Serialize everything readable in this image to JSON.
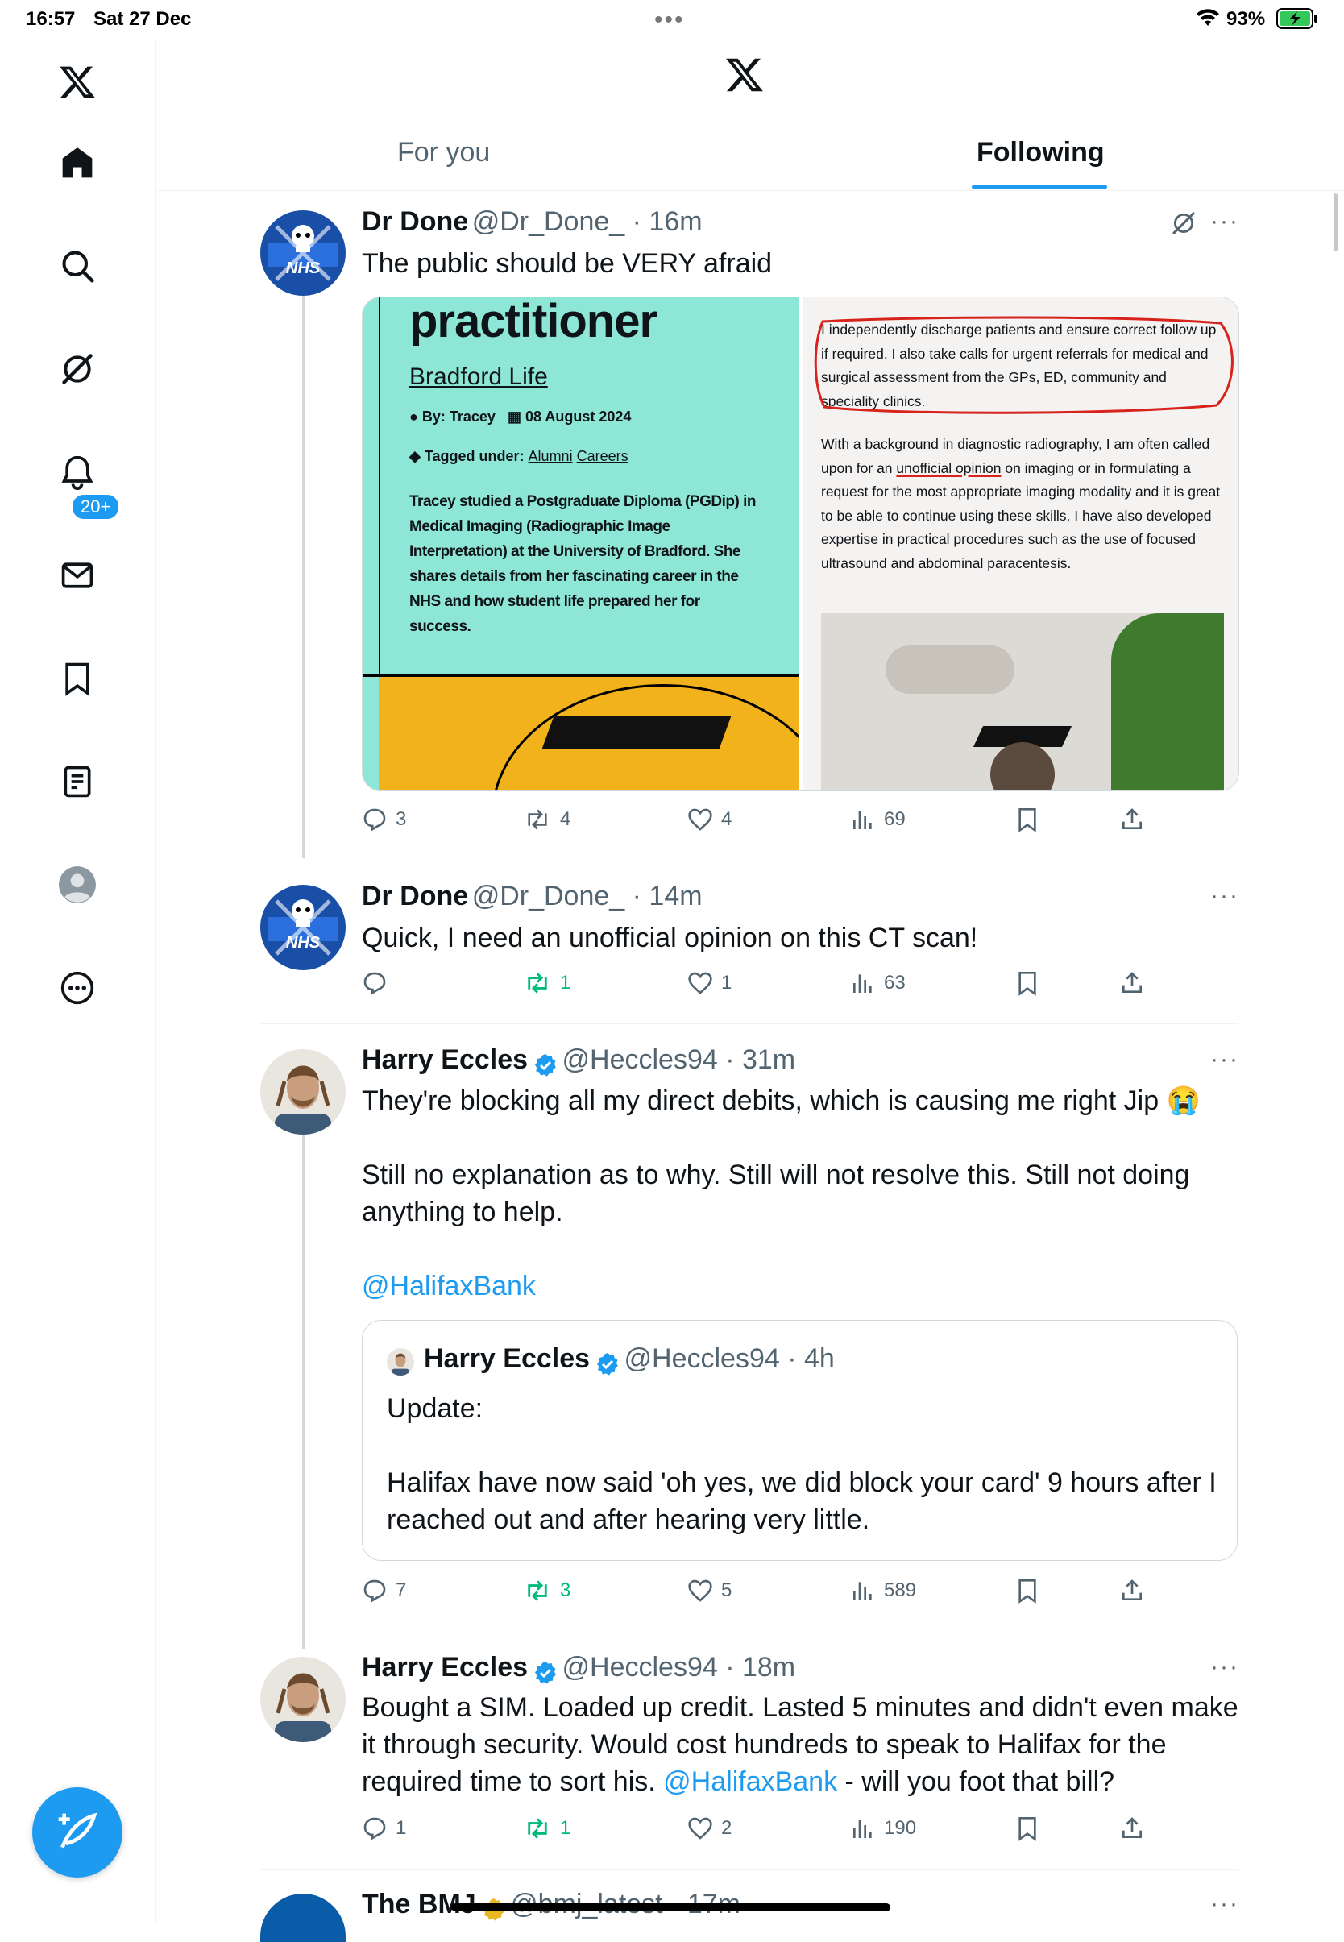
{
  "status_bar": {
    "time": "16:57",
    "date": "Sat 27 Dec",
    "battery": "93%"
  },
  "header": {
    "tabs": [
      {
        "label": "For you"
      },
      {
        "label": "Following",
        "active": true
      }
    ]
  },
  "sidebar": {
    "notifications_badge": "20+"
  },
  "colors": {
    "accent": "#1d9bf0",
    "repost_green": "#00ba7c",
    "muted": "#536471"
  },
  "tweets": [
    {
      "name": "Dr Done",
      "handle": "@Dr_Done_",
      "time": "16m",
      "text": "The public should be VERY afraid",
      "media": {
        "left": {
          "heading": "practitioner",
          "link": "Bradford Life",
          "by": "By: Tracey",
          "date": "08 August 2024",
          "tagged_label": "Tagged under:",
          "tags": [
            "Alumni",
            "Careers"
          ],
          "body": "Tracey studied a Postgraduate Diploma (PGDip) in Medical Imaging (Radiographic Image Interpretation) at the University of Bradford. She shares details from her fascinating career in the NHS and how student life prepared her for success."
        },
        "right": {
          "para1": "I independently discharge patients and ensure correct follow up if required.  I also take calls for urgent referrals for medical and surgical assessment from the GPs, ED, community and speciality clinics.",
          "para2_pre": "With a background in diagnostic radiography, I am often called upon for an ",
          "para2_em": "unofficial opinion",
          "para2_post": " on imaging or in formulating a request for the most appropriate imaging modality and it is great to be able to continue using these skills. I have also developed expertise in practical procedures such as the use of focused ultrasound and abdominal paracentesis."
        }
      },
      "replies": "3",
      "reposts": "4",
      "likes": "4",
      "views": "69"
    },
    {
      "name": "Dr Done",
      "handle": "@Dr_Done_",
      "time": "14m",
      "text": "Quick, I need an unofficial opinion on this CT scan!",
      "replies": "",
      "reposts": "1",
      "likes": "1",
      "views": "63"
    },
    {
      "name": "Harry Eccles",
      "handle": "@Heccles94",
      "time": "31m",
      "text_line1": "They're blocking all my direct debits, which is causing me right Jip 😭",
      "text_line2": "Still no explanation as to why. Still will not resolve this. Still not doing anything to help.",
      "mention": "@HalifaxBank",
      "quote": {
        "name": "Harry Eccles",
        "handle": "@Heccles94",
        "time": "4h",
        "text_line1": "Update:",
        "text_line2": "Halifax have now said 'oh yes, we did block your card' 9 hours after I reached out and after hearing very little."
      },
      "replies": "7",
      "reposts": "3",
      "likes": "5",
      "views": "589"
    },
    {
      "name": "Harry Eccles",
      "handle": "@Heccles94",
      "time": "18m",
      "text_pre": "Bought a SIM. Loaded up credit. Lasted 5 minutes and didn't even make it through security. Would cost hundreds to speak to Halifax for the required time to sort his. ",
      "mention": "@HalifaxBank",
      "text_post": " - will you foot that bill?",
      "replies": "1",
      "reposts": "1",
      "likes": "2",
      "views": "190"
    },
    {
      "name": "The BMJ",
      "handle": "@bmj_latest",
      "time": "17m"
    }
  ]
}
